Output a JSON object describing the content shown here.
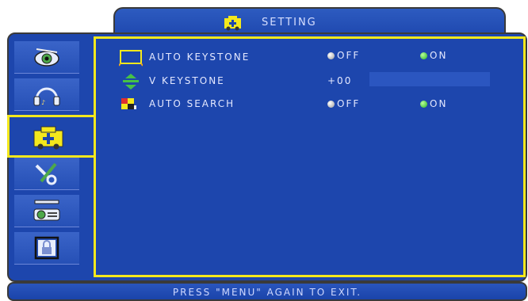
{
  "header": {
    "title": "SETTING",
    "icon": "setting-icon"
  },
  "sidebar": {
    "items": [
      {
        "name": "eye-icon"
      },
      {
        "name": "headphones-icon"
      },
      {
        "name": "setting-icon",
        "selected": true
      },
      {
        "name": "tools-icon"
      },
      {
        "name": "projector-icon"
      },
      {
        "name": "lock-icon"
      }
    ]
  },
  "menu": {
    "auto_keystone": {
      "label": "AUTO KEYSTONE",
      "off": "OFF",
      "on": "ON",
      "icon": "keystone-frame-icon"
    },
    "v_keystone": {
      "label": "V KEYSTONE",
      "value": "+00",
      "icon": "v-keystone-icon"
    },
    "auto_search": {
      "label": "AUTO SEARCH",
      "off": "OFF",
      "on": "ON",
      "icon": "auto-search-icon"
    }
  },
  "footer": {
    "text": "PRESS \"MENU\" AGAIN TO EXIT."
  },
  "colors": {
    "background": "#1d46ad",
    "highlight": "#f4e81c",
    "text": "#e4e8ff"
  }
}
